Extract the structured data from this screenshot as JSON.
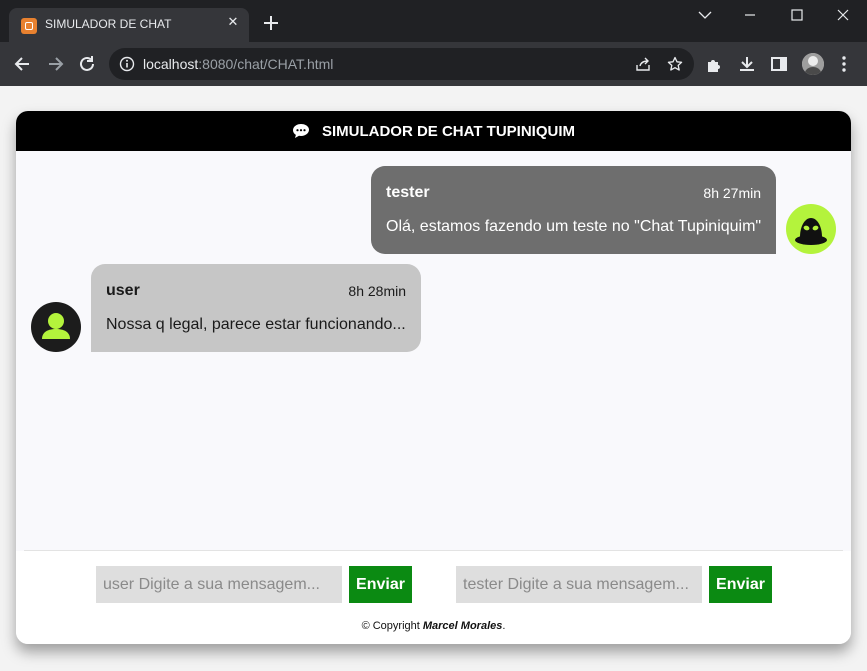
{
  "browser": {
    "tab_title": "SIMULADOR DE CHAT",
    "tab_close": "✕",
    "url_host": "localhost",
    "url_rest": ":8080/chat/CHAT.html"
  },
  "chat": {
    "title": "SIMULADOR DE CHAT TUPINIQUIM",
    "messages": [
      {
        "name": "tester",
        "time": "8h 27min",
        "text": "Olá, estamos fazendo um teste no \"Chat Tupiniquim\""
      },
      {
        "name": "user",
        "time": "8h 28min",
        "text": "Nossa q legal, parece estar funcionando..."
      }
    ]
  },
  "composer": {
    "user_placeholder": "user Digite a sua mensagem...",
    "tester_placeholder": "tester Digite a sua mensagem...",
    "send_label": "Enviar"
  },
  "footer": {
    "copyright_prefix": "© Copyright ",
    "author": "Marcel Morales",
    "suffix": "."
  },
  "colors": {
    "header_bg": "#000000",
    "tester_bubble": "#6e6e6e",
    "user_bubble": "#c6c6c6",
    "avatar_accent": "#b4f33c",
    "send_button": "#0b8a12"
  }
}
